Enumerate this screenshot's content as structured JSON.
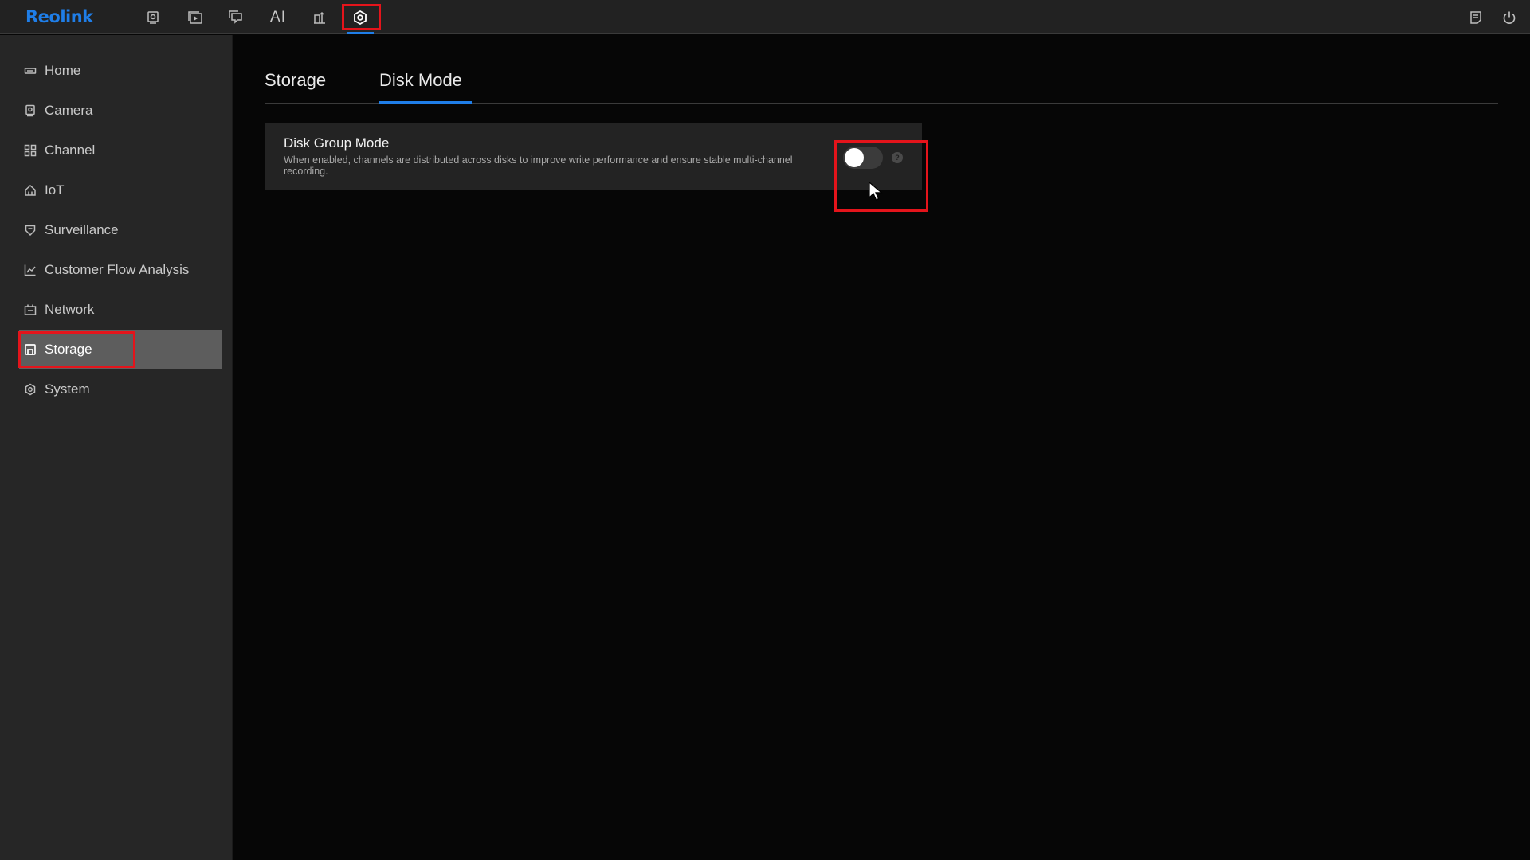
{
  "brand": {
    "logo": "Reolink",
    "accent": "#1f7ee8",
    "highlight": "#e4141b"
  },
  "topbar": {
    "items": [
      {
        "icon": "live-view-icon"
      },
      {
        "icon": "playback-icon"
      },
      {
        "icon": "message-icon"
      },
      {
        "icon": "ai-icon",
        "label": "AI"
      },
      {
        "icon": "customer-flow-icon"
      },
      {
        "icon": "settings-icon",
        "active": true
      }
    ],
    "right": [
      {
        "icon": "log-icon"
      },
      {
        "icon": "power-icon"
      }
    ]
  },
  "sidebar": {
    "items": [
      {
        "label": "Home",
        "icon": "home-icon"
      },
      {
        "label": "Camera",
        "icon": "camera-icon"
      },
      {
        "label": "Channel",
        "icon": "channel-icon"
      },
      {
        "label": "IoT",
        "icon": "iot-icon"
      },
      {
        "label": "Surveillance",
        "icon": "shield-icon"
      },
      {
        "label": "Customer Flow Analysis",
        "icon": "chart-icon"
      },
      {
        "label": "Network",
        "icon": "network-icon"
      },
      {
        "label": "Storage",
        "icon": "storage-icon",
        "active": true
      },
      {
        "label": "System",
        "icon": "gear-icon"
      }
    ]
  },
  "main": {
    "tabs": [
      {
        "label": "Storage"
      },
      {
        "label": "Disk Mode",
        "active": true
      }
    ],
    "setting": {
      "title": "Disk Group Mode",
      "description": "When enabled, channels are distributed across disks to improve write performance and ensure stable multi-channel recording.",
      "enabled": false,
      "help": "?"
    }
  }
}
